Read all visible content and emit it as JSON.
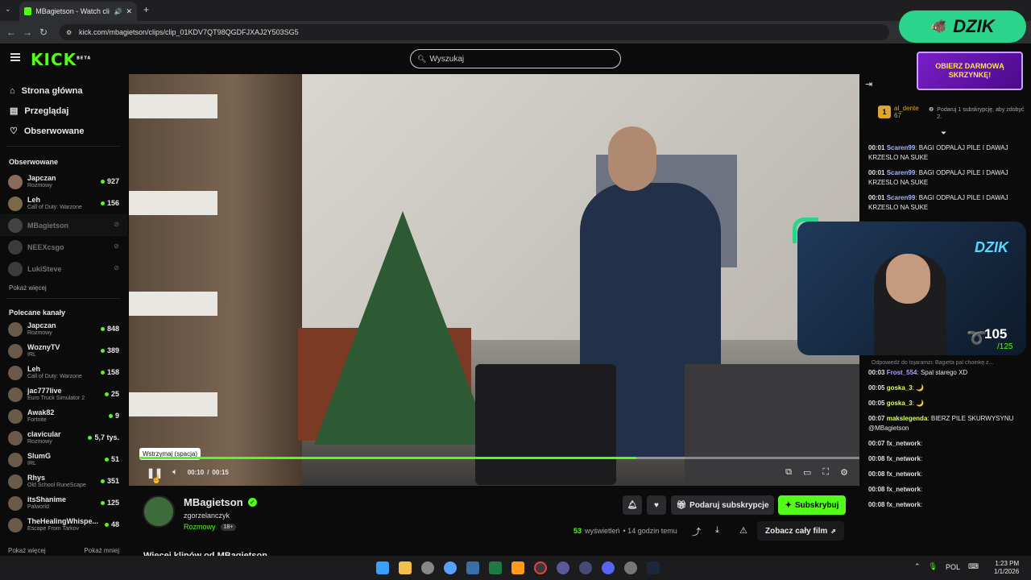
{
  "browser": {
    "tab_title": "MBagietson - Watch clips o",
    "url": "kick.com/mbagietson/clips/clip_01KDV7QT98QGDFJXAJ2Y503SG5"
  },
  "header": {
    "logo": "KICK",
    "logo_badge": "BETA",
    "search_placeholder": "Wyszukaj",
    "promo_text": "OBIERZ DARMOWĄ SKRZYNKĘ!"
  },
  "sidebar": {
    "nav": [
      {
        "label": "Strona główna",
        "icon": "home-icon"
      },
      {
        "label": "Przeglądaj",
        "icon": "browse-icon"
      },
      {
        "label": "Obserwowane",
        "icon": "heart-icon"
      }
    ],
    "followed_title": "Obserwowane",
    "followed": [
      {
        "name": "Japczan",
        "game": "Rozmowy",
        "viewers": "927",
        "live": true
      },
      {
        "name": "Leh",
        "game": "Call of Duty: Warzone",
        "viewers": "156",
        "live": true
      },
      {
        "name": "MBagietson",
        "game": "",
        "viewers": "",
        "live": false
      },
      {
        "name": "NEEXcsgo",
        "game": "",
        "viewers": "",
        "live": false
      },
      {
        "name": "LukiSteve",
        "game": "",
        "viewers": "",
        "live": false
      }
    ],
    "show_more": "Pokaż więcej",
    "recommended_title": "Polecane kanały",
    "recommended": [
      {
        "name": "Japczan",
        "game": "Rozmowy",
        "viewers": "848"
      },
      {
        "name": "WoznyTV",
        "game": "IRL",
        "viewers": "389"
      },
      {
        "name": "Leh",
        "game": "Call of Duty: Warzone",
        "viewers": "158"
      },
      {
        "name": "jac777live",
        "game": "Euro Truck Simulator 2",
        "viewers": "25"
      },
      {
        "name": "Awak82",
        "game": "Fortnite",
        "viewers": "9"
      },
      {
        "name": "clavicular",
        "game": "Rozmowy",
        "viewers": "5,7 tys."
      },
      {
        "name": "SlumG",
        "game": "IRL",
        "viewers": "51"
      },
      {
        "name": "Rhys",
        "game": "Old School RuneScape",
        "viewers": "351"
      },
      {
        "name": "itsShanime",
        "game": "Palworld",
        "viewers": "125"
      },
      {
        "name": "TheHealingWhispe...",
        "game": "Escape From Tarkov",
        "viewers": "48"
      }
    ],
    "show_more_bottom": "Pokaż więcej",
    "show_less_bottom": "Pokaż mniej"
  },
  "player": {
    "tooltip": "Wstrzymaj (spacja)",
    "current_time": "00:10",
    "separator": "/",
    "duration": "00:15",
    "progress": 0.69
  },
  "channel": {
    "name": "MBagietson",
    "clip_author": "zgorzelanczyk",
    "category": "Rozmowy",
    "age_badge": "18+",
    "views_count": "53",
    "views_label": "wyświetleń",
    "time_ago": "• 14 godzin temu",
    "gift_label": "Podaruj subskrypcje",
    "subscribe_label": "Subskrybuj",
    "watch_full_label": "Zobacz cały film",
    "more_clips": "Więcej klipów od MBagietson"
  },
  "chat": {
    "leader_name": "al_dente",
    "leader_count": "67",
    "leader_rank": "1",
    "gift_hint": "Podaruj 1 subskrypcję, aby zdobyć 2.",
    "reply_hint": "Odpowiedź do tojaramzi: Bagieta pal choinkę z...",
    "messages": [
      {
        "time": "00:01",
        "user": "Scaren99",
        "color": "#a0b8ff",
        "text": "BAGI ODPALAJ PILE I DAWAJ KRZESLO NA SUKE"
      },
      {
        "time": "00:01",
        "user": "Scaren99",
        "color": "#a0b8ff",
        "text": "BAGI ODPALAJ PILE I DAWAJ KRZESLO NA SUKE"
      },
      {
        "time": "00:01",
        "user": "Scaren99",
        "color": "#a0b8ff",
        "text": "BAGI ODPALAJ PILE I DAWAJ KRZESLO NA SUKE"
      }
    ],
    "messages2": [
      {
        "time": "00:03",
        "user": "Frost_554",
        "color": "#b49cff",
        "text": "Spal starego XD"
      },
      {
        "time": "00:05",
        "user": "goska_3",
        "color": "#d8ff5a",
        "text": "🌙"
      },
      {
        "time": "00:05",
        "user": "goska_3",
        "color": "#d8ff5a",
        "text": "🌙"
      },
      {
        "time": "00:07",
        "user": "makslegenda",
        "color": "#d8ff5a",
        "text": "BIERZ PILE SKURWYSYNU @MBagietson"
      },
      {
        "time": "00:07",
        "user": "fx_network",
        "color": "#e0e0e0",
        "text": ""
      },
      {
        "time": "00:08",
        "user": "fx_network",
        "color": "#e0e0e0",
        "text": ""
      },
      {
        "time": "00:08",
        "user": "fx_network",
        "color": "#e0e0e0",
        "text": ""
      },
      {
        "time": "00:08",
        "user": "fx_network",
        "color": "#e0e0e0",
        "text": ""
      },
      {
        "time": "00:08",
        "user": "fx_network",
        "color": "#e0e0e0",
        "text": ""
      }
    ]
  },
  "overlay": {
    "brand": "DZIK",
    "cam_brand": "DZIK",
    "counter": "105",
    "counter_total": "/125"
  },
  "taskbar": {
    "lang": "POL",
    "time": "1:23 PM",
    "date": "1/1/2026"
  },
  "colors": {
    "accent": "#53fc18",
    "background": "#0b0b0c"
  }
}
